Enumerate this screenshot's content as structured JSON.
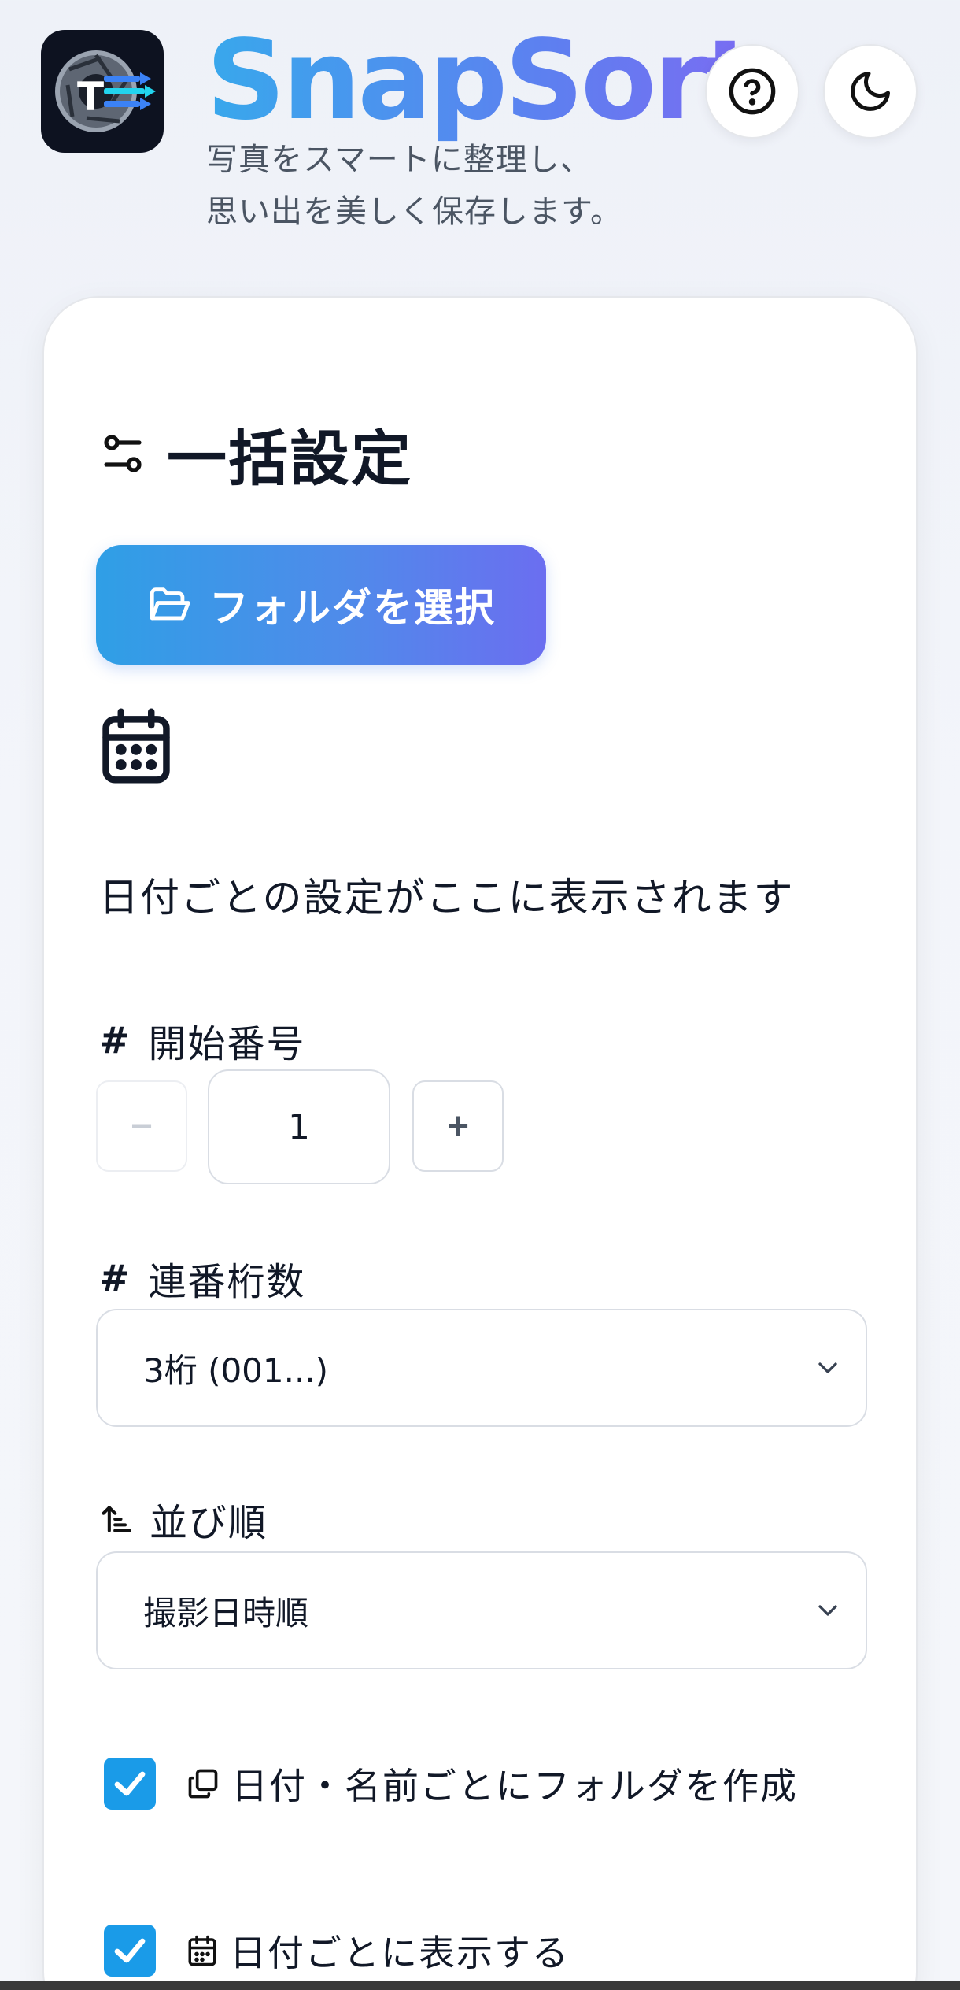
{
  "header": {
    "title": "SnapSort",
    "tagline_line1": "写真をスマートに整理し、",
    "tagline_line2": "思い出を美しく保存します。"
  },
  "icons": {
    "logo": "app-logo-icon",
    "help": "help-icon",
    "theme": "moon-icon",
    "settings": "sliders-icon",
    "folder": "folder-open-icon",
    "calendar": "calendar-icon",
    "sort": "sort-icon",
    "copy": "copy-icon",
    "chevron": "chevron-down-icon",
    "check": "check-icon"
  },
  "colors": {
    "accent_start": "#2f9fe6",
    "accent_end": "#6b6ef0",
    "checkbox": "#1a9be8"
  },
  "card": {
    "title": "一括設定",
    "select_folder_label": "フォルダを選択",
    "date_placeholder": "日付ごとの設定がここに表示されます",
    "start_number": {
      "label": "開始番号",
      "hash": "#",
      "decrement": "−",
      "increment": "+",
      "value": "1"
    },
    "digits": {
      "label": "連番桁数",
      "hash": "#",
      "selected": "3桁 (001...)"
    },
    "sort_order": {
      "label": "並び順",
      "selected": "撮影日時順"
    },
    "options": [
      {
        "label": "日付・名前ごとにフォルダを作成",
        "checked": true
      },
      {
        "label": "日付ごとに表示する",
        "checked": true
      }
    ]
  }
}
